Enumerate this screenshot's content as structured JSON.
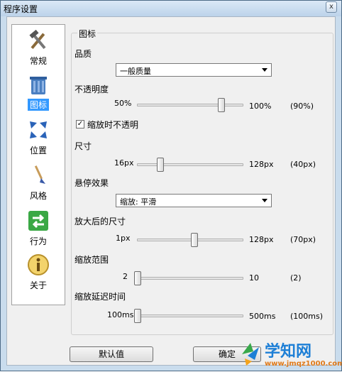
{
  "window": {
    "title": "程序设置",
    "close_symbol": "x"
  },
  "sidebar": {
    "items": [
      {
        "label": "常规",
        "icon": "tools-icon",
        "selected": false
      },
      {
        "label": "图标",
        "icon": "recycle-bin-icon",
        "selected": true
      },
      {
        "label": "位置",
        "icon": "move-arrows-icon",
        "selected": false
      },
      {
        "label": "风格",
        "icon": "paintbrush-icon",
        "selected": false
      },
      {
        "label": "行为",
        "icon": "exchange-arrows-icon",
        "selected": false
      },
      {
        "label": "关于",
        "icon": "info-icon",
        "selected": false
      }
    ]
  },
  "group": {
    "title": "图标"
  },
  "quality": {
    "label": "品质",
    "value": "一般质量"
  },
  "opacity": {
    "label": "不透明度",
    "min_label": "50%",
    "max_label": "100%",
    "value_label": "(90%)",
    "value": 90,
    "min": 50,
    "max": 100
  },
  "zoom_opaque": {
    "label": "缩放时不透明",
    "checked": true,
    "check_glyph": "✓"
  },
  "size": {
    "label": "尺寸",
    "min_label": "16px",
    "max_label": "128px",
    "value_label": "(40px)",
    "value": 40,
    "min": 16,
    "max": 128
  },
  "hover": {
    "label": "悬停效果",
    "value": "缩放: 平滑"
  },
  "zoomed_size": {
    "label": "放大后的尺寸",
    "min_label": "1px",
    "max_label": "128px",
    "value_label": "(70px)",
    "value": 70,
    "min": 1,
    "max": 128
  },
  "zoom_range": {
    "label": "缩放范围",
    "min_label": "2",
    "max_label": "10",
    "value_label": "(2)",
    "value": 2,
    "min": 2,
    "max": 10
  },
  "zoom_delay": {
    "label": "缩放延迟时间",
    "min_label": "100ms",
    "max_label": "500ms",
    "value_label": "(100ms)",
    "value": 100,
    "min": 100,
    "max": 500
  },
  "buttons": {
    "default_label": "默认值",
    "ok_label": "确定"
  },
  "watermark": {
    "title": "学知网",
    "url": "www.jmqz1000.com"
  }
}
